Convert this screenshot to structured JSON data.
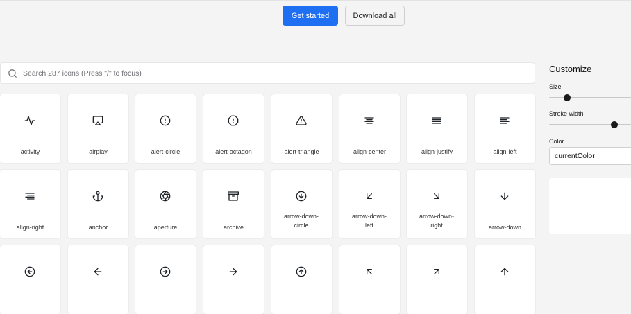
{
  "header": {
    "get_started_label": "Get started",
    "download_all_label": "Download all"
  },
  "search": {
    "placeholder": "Search 287 icons (Press \"/\" to focus)",
    "value": ""
  },
  "icons": [
    {
      "name": "activity",
      "icon": "activity-icon"
    },
    {
      "name": "airplay",
      "icon": "airplay-icon"
    },
    {
      "name": "alert-circle",
      "icon": "alert-circle-icon"
    },
    {
      "name": "alert-octagon",
      "icon": "alert-octagon-icon"
    },
    {
      "name": "alert-triangle",
      "icon": "alert-triangle-icon"
    },
    {
      "name": "align-center",
      "icon": "align-center-icon"
    },
    {
      "name": "align-justify",
      "icon": "align-justify-icon"
    },
    {
      "name": "align-left",
      "icon": "align-left-icon"
    },
    {
      "name": "align-right",
      "icon": "align-right-icon"
    },
    {
      "name": "anchor",
      "icon": "anchor-icon"
    },
    {
      "name": "aperture",
      "icon": "aperture-icon"
    },
    {
      "name": "archive",
      "icon": "archive-icon"
    },
    {
      "name": "arrow-down-circle",
      "icon": "arrow-down-circle-icon"
    },
    {
      "name": "arrow-down-left",
      "icon": "arrow-down-left-icon"
    },
    {
      "name": "arrow-down-right",
      "icon": "arrow-down-right-icon"
    },
    {
      "name": "arrow-down",
      "icon": "arrow-down-icon"
    },
    {
      "name": "",
      "icon": "arrow-left-circle-icon"
    },
    {
      "name": "",
      "icon": "arrow-left-icon"
    },
    {
      "name": "",
      "icon": "arrow-right-circle-icon"
    },
    {
      "name": "",
      "icon": "arrow-right-icon"
    },
    {
      "name": "",
      "icon": "arrow-up-circle-icon"
    },
    {
      "name": "",
      "icon": "arrow-up-left-icon"
    },
    {
      "name": "",
      "icon": "arrow-up-right-icon"
    },
    {
      "name": "",
      "icon": "arrow-up-icon"
    }
  ],
  "customize": {
    "title": "Customize",
    "size_label": "Size",
    "size_value": 0.22,
    "stroke_label": "Stroke width",
    "stroke_value": 0.8,
    "color_label": "Color",
    "color_value": "currentColor"
  },
  "colors": {
    "primary": "#1f6ff2",
    "background": "#f4f4f5",
    "tile": "#ffffff"
  }
}
